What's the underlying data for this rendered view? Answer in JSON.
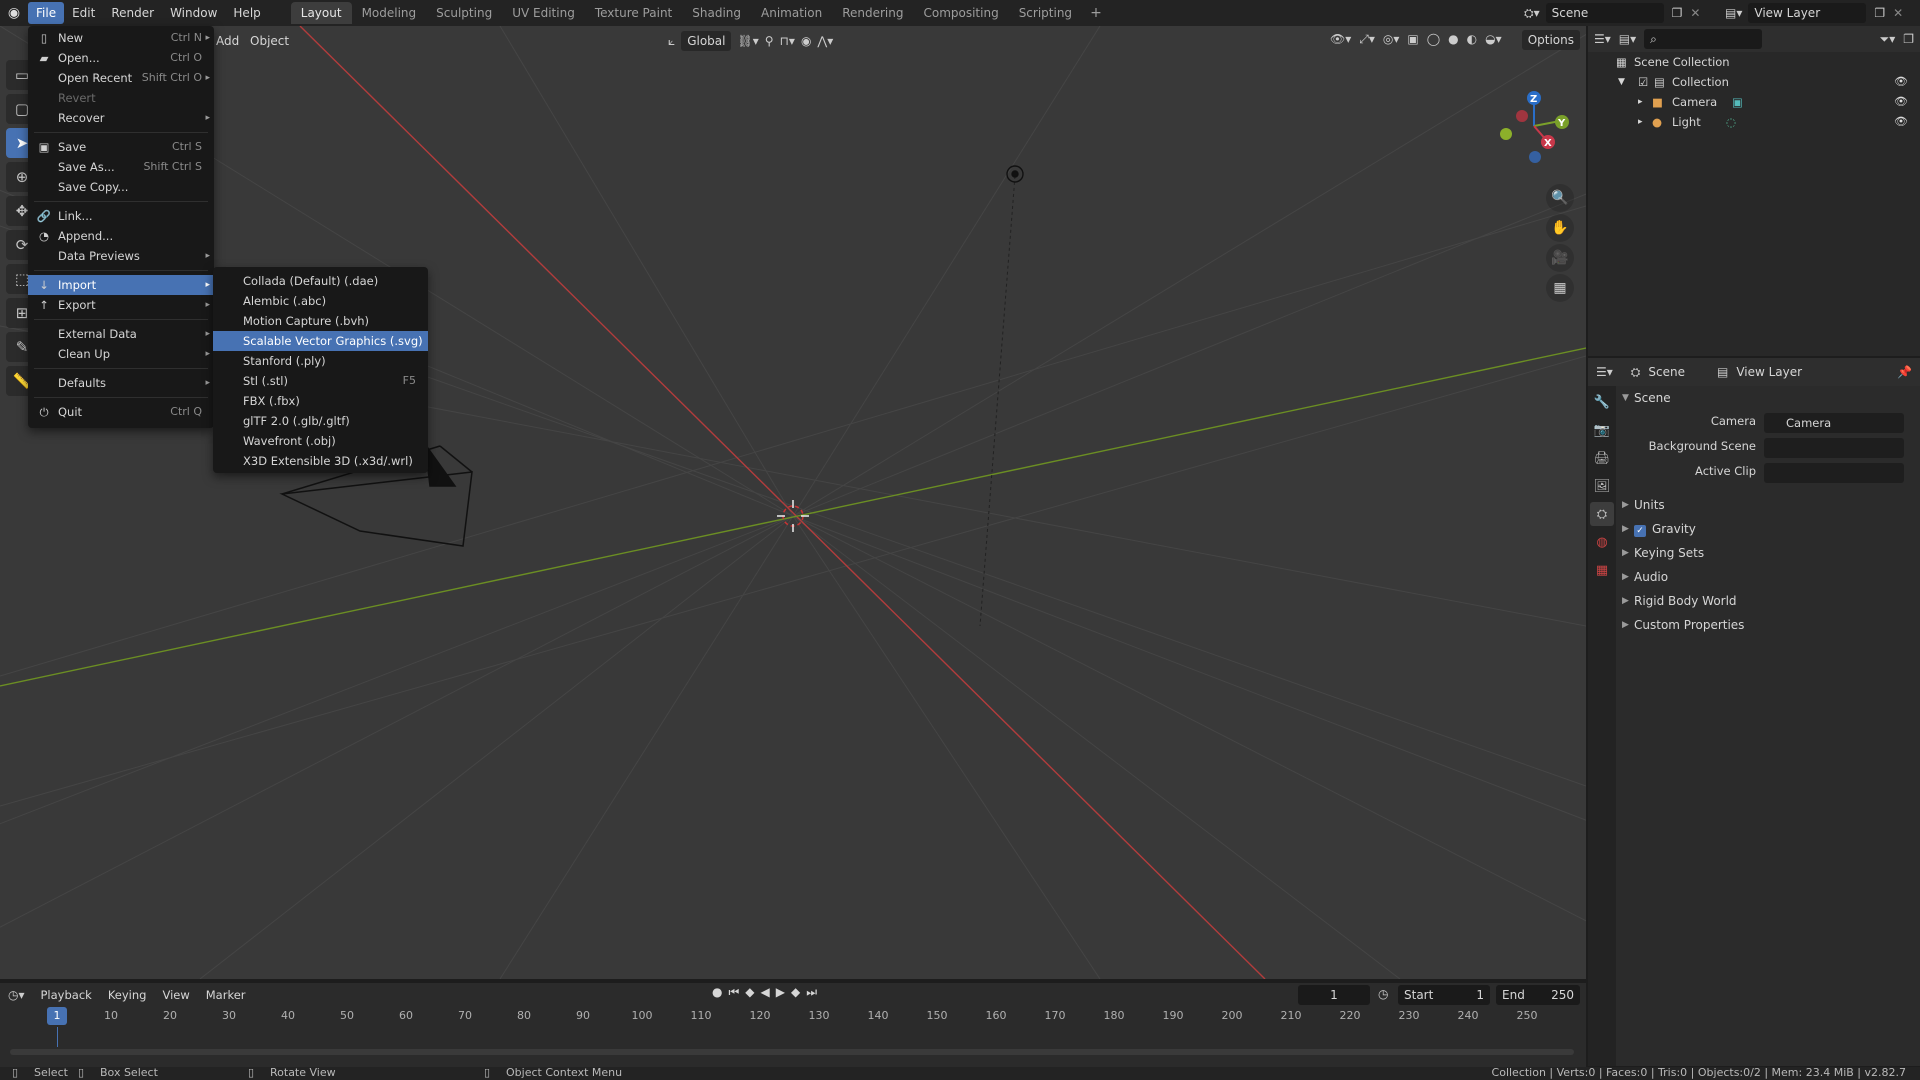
{
  "topbar": {
    "menus": [
      "File",
      "Edit",
      "Render",
      "Window",
      "Help"
    ],
    "workspaces": [
      "Layout",
      "Modeling",
      "Sculpting",
      "UV Editing",
      "Texture Paint",
      "Shading",
      "Animation",
      "Rendering",
      "Compositing",
      "Scripting"
    ],
    "active_workspace": "Layout",
    "scene": "Scene",
    "view_layer": "View Layer"
  },
  "viewport": {
    "menus": [
      "Add",
      "Object"
    ],
    "orientation": "Global",
    "options": "Options",
    "gizmo": {
      "z": "Z",
      "y": "Y",
      "x": "X"
    }
  },
  "file_menu": {
    "items": [
      {
        "label": "New",
        "shortcut": "Ctrl N",
        "icon": "new-file-icon",
        "submenu": true
      },
      {
        "label": "Open...",
        "shortcut": "Ctrl O",
        "icon": "folder-icon"
      },
      {
        "label": "Open Recent",
        "shortcut": "Shift Ctrl O",
        "submenu": true
      },
      {
        "label": "Revert",
        "disabled": true
      },
      {
        "label": "Recover",
        "submenu": true
      },
      {
        "label": "Save",
        "shortcut": "Ctrl S",
        "icon": "save-icon"
      },
      {
        "label": "Save As...",
        "shortcut": "Shift Ctrl S"
      },
      {
        "label": "Save Copy..."
      },
      {
        "label": "Link...",
        "icon": "link-icon"
      },
      {
        "label": "Append...",
        "icon": "append-icon"
      },
      {
        "label": "Data Previews",
        "submenu": true
      },
      {
        "label": "Import",
        "icon": "import-icon",
        "submenu": true
      },
      {
        "label": "Export",
        "icon": "export-icon",
        "submenu": true
      },
      {
        "label": "External Data",
        "submenu": true
      },
      {
        "label": "Clean Up",
        "submenu": true
      },
      {
        "label": "Defaults",
        "submenu": true
      },
      {
        "label": "Quit",
        "shortcut": "Ctrl Q",
        "icon": "power-icon"
      }
    ]
  },
  "import_menu": {
    "items": [
      {
        "label": "Collada (Default) (.dae)"
      },
      {
        "label": "Alembic (.abc)"
      },
      {
        "label": "Motion Capture (.bvh)"
      },
      {
        "label": "Scalable Vector Graphics (.svg)"
      },
      {
        "label": "Stanford (.ply)"
      },
      {
        "label": "Stl (.stl)",
        "shortcut": "F5"
      },
      {
        "label": "FBX (.fbx)"
      },
      {
        "label": "glTF 2.0 (.glb/.gltf)"
      },
      {
        "label": "Wavefront (.obj)"
      },
      {
        "label": "X3D Extensible 3D (.x3d/.wrl)"
      }
    ]
  },
  "outliner": {
    "scene_collection": "Scene Collection",
    "collection": "Collection",
    "objects": [
      "Camera",
      "Light"
    ]
  },
  "properties": {
    "tab_scene": "Scene",
    "tab_view_layer": "View Layer",
    "panel_title": "Scene",
    "camera_label": "Camera",
    "camera_value": "Camera",
    "background_scene_label": "Background Scene",
    "active_clip_label": "Active Clip",
    "subpanels": [
      "Units",
      "Gravity",
      "Keying Sets",
      "Audio",
      "Rigid Body World",
      "Custom Properties"
    ]
  },
  "timeline": {
    "menus": [
      "Playback",
      "Keying",
      "View",
      "Marker"
    ],
    "current_frame": "1",
    "start_label": "Start",
    "start": "1",
    "end_label": "End",
    "end": "250",
    "ticks": [
      "10",
      "20",
      "30",
      "40",
      "50",
      "60",
      "70",
      "80",
      "90",
      "100",
      "110",
      "120",
      "130",
      "140",
      "150",
      "160",
      "170",
      "180",
      "190",
      "200",
      "210",
      "220",
      "230",
      "240",
      "250"
    ]
  },
  "statusbar": {
    "select": "Select",
    "box_select": "Box Select",
    "rotate_view": "Rotate View",
    "context_menu": "Object Context Menu",
    "stats": "Collection | Verts:0 | Faces:0 | Tris:0 | Objects:0/2 | Mem: 23.4 MiB | v2.82.7"
  },
  "colors": {
    "accent": "#4772b3",
    "x_axis": "#b23c3c",
    "y_axis": "#6b8e23"
  }
}
